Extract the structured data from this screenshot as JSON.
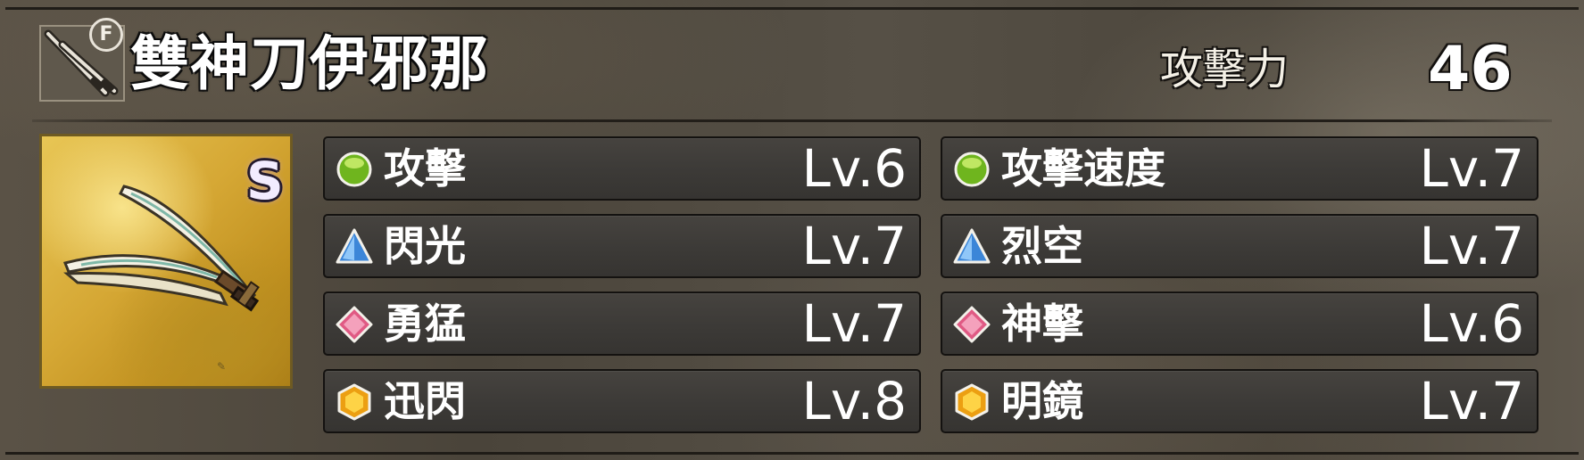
{
  "weapon": {
    "name": "雙神刀伊邪那",
    "type_icon": "dual-katana-icon",
    "tier_badge": "F",
    "rarity": "S",
    "portrait": "dual-katana-artwork"
  },
  "stats": {
    "attack_label": "攻擊力",
    "attack_value": "46"
  },
  "colors": {
    "gem_green": "#7cc421",
    "gem_blue": "#3f8fe0",
    "gem_pink": "#e46a8e",
    "gem_gold": "#f0b020"
  },
  "skills": [
    {
      "name": "攻擊",
      "level": "Lv.6",
      "gem": "green-orb-icon"
    },
    {
      "name": "攻擊速度",
      "level": "Lv.7",
      "gem": "green-orb-icon"
    },
    {
      "name": "閃光",
      "level": "Lv.7",
      "gem": "blue-triangle-icon"
    },
    {
      "name": "烈空",
      "level": "Lv.7",
      "gem": "blue-triangle-icon"
    },
    {
      "name": "勇猛",
      "level": "Lv.7",
      "gem": "pink-diamond-icon"
    },
    {
      "name": "神擊",
      "level": "Lv.6",
      "gem": "pink-diamond-icon"
    },
    {
      "name": "迅閃",
      "level": "Lv.8",
      "gem": "gold-hexagon-icon"
    },
    {
      "name": "明鏡",
      "level": "Lv.7",
      "gem": "gold-hexagon-icon"
    }
  ]
}
